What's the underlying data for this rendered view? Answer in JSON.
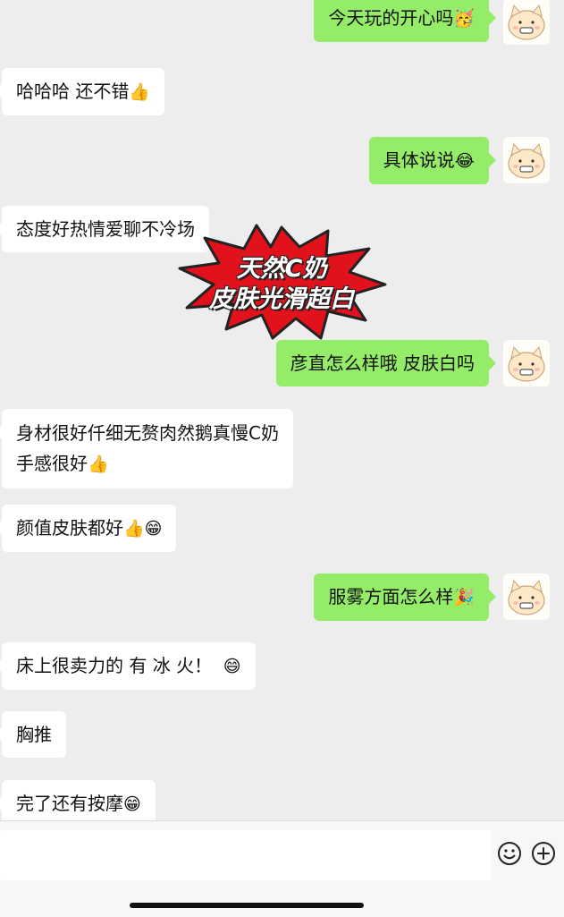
{
  "messages": [
    {
      "side": "out",
      "text": "今天玩的开心吗",
      "emoji": "🥳"
    },
    {
      "side": "in",
      "text": "哈哈哈 还不错",
      "emoji": "👍"
    },
    {
      "side": "out",
      "text": "具体说说",
      "emoji": "😂"
    },
    {
      "side": "in",
      "text": "态度好热情爱聊不冷场",
      "emoji": ""
    },
    {
      "side": "out",
      "text": "彦直怎么样哦 皮肤白吗",
      "emoji": ""
    },
    {
      "side": "in",
      "text": "身材很好仟细无赘肉然鹅真慢C奶",
      "text2": "手感很好",
      "emoji": "👍"
    },
    {
      "side": "in",
      "text": "颜值皮肤都好",
      "emoji": "👍😁"
    },
    {
      "side": "out",
      "text": "服雾方面怎么样",
      "emoji": "🎉"
    },
    {
      "side": "in",
      "text": "床上很卖力的 有 冰 火！",
      "emoji": "😄"
    },
    {
      "side": "in",
      "text": "胸推",
      "emoji": ""
    },
    {
      "side": "in",
      "text": "完了还有按摩",
      "emoji": "😁"
    }
  ],
  "sticker": {
    "line1": "天然C奶",
    "line2": "皮肤光滑超白",
    "color": "#e1121b"
  },
  "input": {
    "placeholder": ""
  },
  "icons": {
    "emoji": "smile-icon",
    "plus": "plus-icon"
  }
}
